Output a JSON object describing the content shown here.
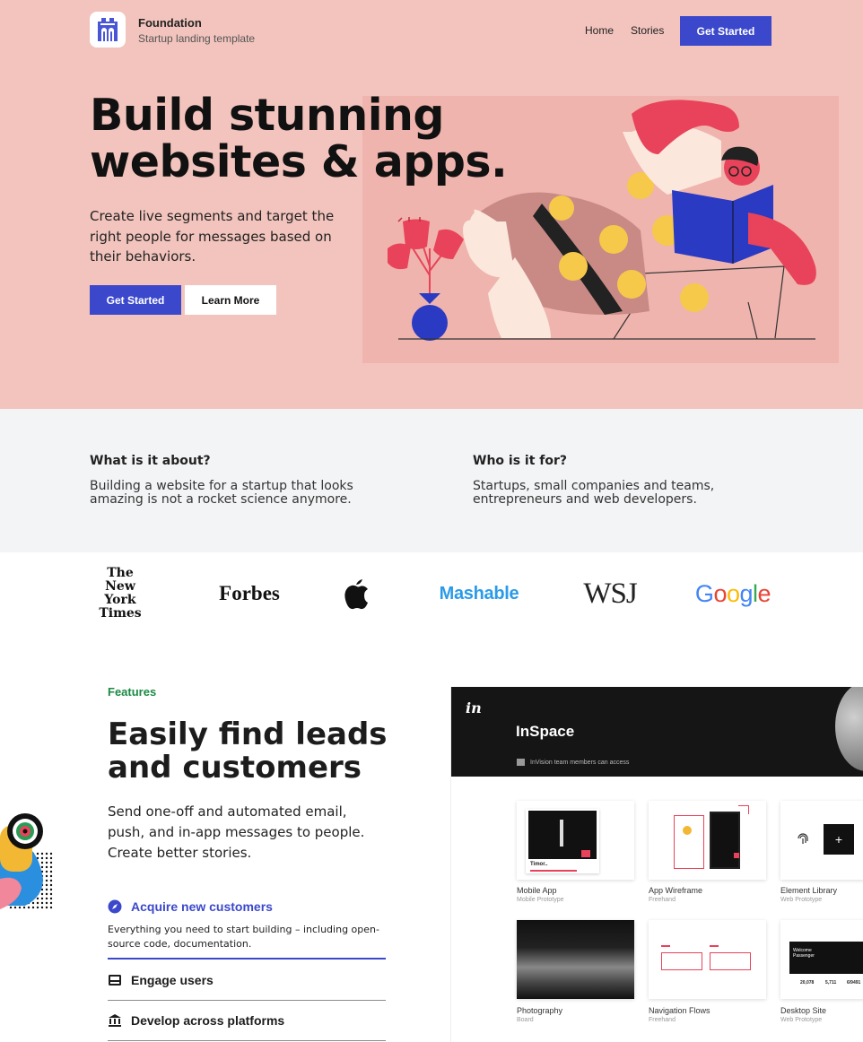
{
  "nav": {
    "brand_name": "Foundation",
    "brand_tagline": "Startup landing template",
    "links": [
      "Home",
      "Stories"
    ],
    "cta": "Get Started"
  },
  "hero": {
    "title": "Build stunning websites & apps.",
    "description": "Create live segments and target the right people for messages based on their behaviors.",
    "primary_button": "Get Started",
    "secondary_button": "Learn More"
  },
  "about": {
    "left": {
      "heading": "What is it about?",
      "text": "Building a website for a startup that looks amazing is not a rocket science anymore."
    },
    "right": {
      "heading": "Who is it for?",
      "text": "Startups, small companies and teams, entrepreneurs and web developers."
    }
  },
  "press_logos": {
    "nyt": [
      "The",
      "New York",
      "Times"
    ],
    "forbes": "Forbes",
    "apple": "apple-logo-icon",
    "mashable": "Mashable",
    "wsj": "WSJ",
    "google": [
      "G",
      "o",
      "o",
      "g",
      "l",
      "e"
    ],
    "google_colors": [
      "#4285f4",
      "#ea4335",
      "#fbbc05",
      "#4285f4",
      "#34a853",
      "#ea4335"
    ]
  },
  "features": {
    "eyebrow": "Features",
    "title": "Easily find leads and customers",
    "description": "Send one-off and automated email, push, and in-app messages to people. Create better stories.",
    "items": [
      {
        "label": "Acquire new customers",
        "icon": "compass-icon",
        "body": "Everything you need to start building – including open-source code, documentation.",
        "active": true
      },
      {
        "label": "Engage users",
        "icon": "inbox-icon",
        "active": false
      },
      {
        "label": "Develop across platforms",
        "icon": "bank-icon",
        "active": false
      }
    ]
  },
  "mockup": {
    "logo": "in",
    "title": "InSpace",
    "subtitle": "InVision team members can access",
    "cards": [
      {
        "name": "Mobile App",
        "type": "Mobile Prototype"
      },
      {
        "name": "App Wireframe",
        "type": "Freehand"
      },
      {
        "name": "Element Library",
        "type": "Web Prototype"
      },
      {
        "name": "Photography",
        "type": "Board"
      },
      {
        "name": "Navigation Flows",
        "type": "Freehand"
      },
      {
        "name": "Desktop Site",
        "type": "Web Prototype"
      }
    ],
    "mobile_card_caption": "Timor..",
    "desktop_card_caption": "Welcome Passenger",
    "desktop_stats": [
      "20,078",
      "5,711",
      "6/9491"
    ]
  },
  "colors": {
    "hero_bg": "#f2c4bd",
    "accent_blue": "#3b48cc",
    "features_green": "#1b8a43",
    "about_bg": "#f3f4f6"
  }
}
